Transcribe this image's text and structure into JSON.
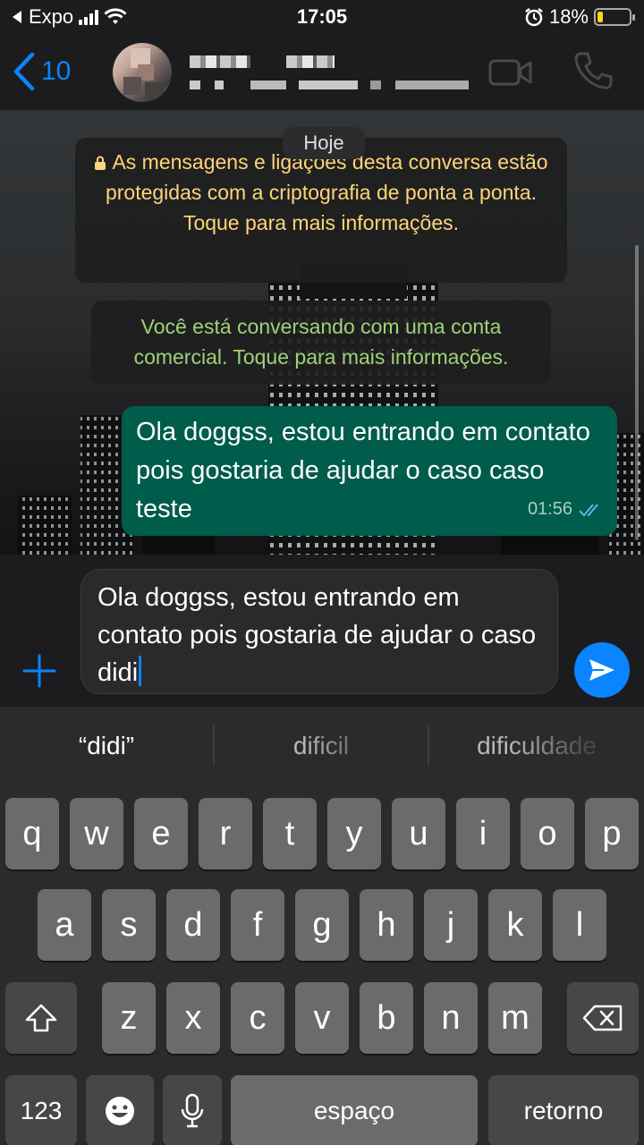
{
  "status_bar": {
    "carrier": "Expo",
    "time": "17:05",
    "battery_percent": "18%",
    "battery_level": 0.18,
    "icons": [
      "back-arrow-icon",
      "signal-icon",
      "wifi-icon",
      "alarm-icon",
      "battery-icon"
    ]
  },
  "header": {
    "back_count": "10",
    "icons": [
      "chevron-left-icon",
      "avatar",
      "video-call-icon",
      "phone-icon"
    ]
  },
  "chat": {
    "date_label": "Hoje",
    "encryption_notice": "As mensagens e ligações desta conversa estão protegidas com a criptografia de ponta a ponta. Toque para mais informações.",
    "business_notice": "Você está conversando com uma conta comercial. Toque para mais informações.",
    "messages": [
      {
        "text": "Ola doggss, estou entrando em contato pois gostaria de ajudar o caso caso teste",
        "time": "01:56",
        "status": "read"
      }
    ]
  },
  "composer": {
    "value": "Ola doggss, estou entrando em contato pois gostaria de ajudar o caso didi",
    "icons": [
      "plus-icon",
      "send-icon"
    ]
  },
  "keyboard": {
    "suggestions": [
      "“didi”",
      "dificil",
      "dificuldade"
    ],
    "row1": [
      "q",
      "w",
      "e",
      "r",
      "t",
      "y",
      "u",
      "i",
      "o",
      "p"
    ],
    "row2": [
      "a",
      "s",
      "d",
      "f",
      "g",
      "h",
      "j",
      "k",
      "l"
    ],
    "row3": [
      "z",
      "x",
      "c",
      "v",
      "b",
      "n",
      "m"
    ],
    "numbers_label": "123",
    "space_label": "espaço",
    "return_label": "retorno",
    "icons": [
      "shift-icon",
      "backspace-icon",
      "emoji-icon",
      "microphone-icon"
    ]
  }
}
